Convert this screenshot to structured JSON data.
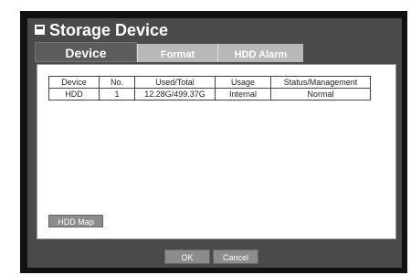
{
  "dialog": {
    "title": "Storage Device",
    "icon": "storage-icon"
  },
  "tabs": [
    {
      "label": "Device",
      "active": true
    },
    {
      "label": "Format",
      "active": false
    },
    {
      "label": "HDD Alarm",
      "active": false
    }
  ],
  "table": {
    "headers": [
      "Device",
      "No.",
      "Used/Total",
      "Usage",
      "Status/Management"
    ],
    "rows": [
      [
        "HDD",
        "1",
        "12.28G/499.37G",
        "Internal",
        "Normal"
      ]
    ]
  },
  "buttons": {
    "hdd_map": "HDD Map",
    "ok": "OK",
    "cancel": "Cancel"
  }
}
